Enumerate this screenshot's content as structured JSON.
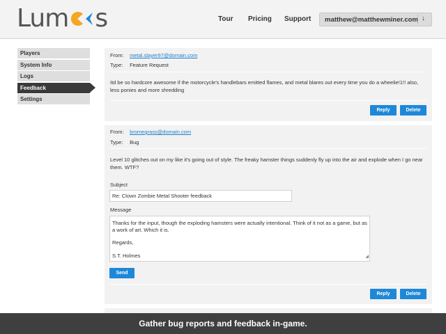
{
  "app": {
    "logo_text_left": "Lum",
    "logo_text_right": "s",
    "colors": {
      "logo_orange": "#f5a623",
      "logo_blue": "#1e88d8",
      "accent": "#1e88d8",
      "sidebar_active": "#3a3a3a"
    }
  },
  "nav": {
    "tour": "Tour",
    "pricing": "Pricing",
    "support": "Support",
    "user_email": "matthew@matthewminer.com",
    "user_menu_icon": "↓"
  },
  "sidebar": {
    "items": [
      {
        "label": "Players"
      },
      {
        "label": "System Info"
      },
      {
        "label": "Logs"
      },
      {
        "label": "Feedback"
      },
      {
        "label": "Settings"
      }
    ]
  },
  "feedback": [
    {
      "from_label": "From:",
      "from": "metal.slayer97@domain.com",
      "type_label": "Type:",
      "type": "Feature Request",
      "message": "Itd be so hardcore awesome if the motorcycle's handlebars emitted flames, and metal blares out every time you do a wheelie!1!! also, less ponies and more shredding",
      "reply_label": "Reply",
      "delete_label": "Delete"
    },
    {
      "from_label": "From:",
      "from": "bromegrass@domain.com",
      "type_label": "Type:",
      "type": "Bug",
      "message": "Level 10 glitches out on my like it's going out of style. The freaky hamster things suddenly fly up into the air and explode when I go near them. WTF?",
      "subject_label": "Subject",
      "subject_value": "Re: Clown Zombie Metal Shooter feedback",
      "message_label": "Message",
      "reply_body_1": "Thanks for the input, though the exploding hamsters were actually intentional. Think of it not as a game, but as a work of art. Which it is.",
      "reply_body_2": "Regards,",
      "reply_body_3": "S.T. Holmes",
      "send_label": "Send",
      "reply_label": "Reply",
      "delete_label": "Delete"
    }
  ],
  "footer": {
    "caption": "Gather bug reports and feedback in-game."
  }
}
